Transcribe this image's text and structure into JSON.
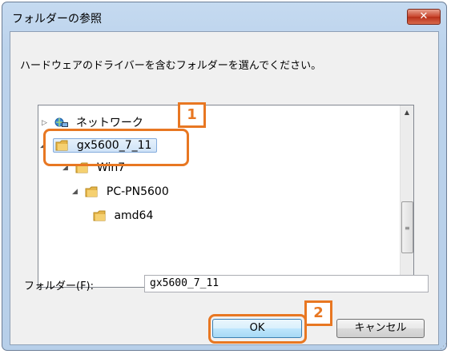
{
  "window": {
    "title": "フォルダーの参照",
    "close_label": "✕"
  },
  "instruction": "ハードウェアのドライバーを含むフォルダーを選んでください。",
  "tree": {
    "items": [
      {
        "label": "ネットワーク",
        "icon": "network-icon"
      },
      {
        "label": "gx5600_7_11",
        "icon": "folder-icon",
        "selected": true
      },
      {
        "label": "Win7",
        "icon": "folder-icon"
      },
      {
        "label": "PC-PN5600",
        "icon": "folder-icon"
      },
      {
        "label": "amd64",
        "icon": "folder-icon"
      }
    ]
  },
  "folder_field": {
    "label": "フォルダー(F):",
    "value": "gx5600_7_11"
  },
  "buttons": {
    "ok": "OK",
    "cancel": "キャンセル"
  },
  "callouts": {
    "one": "1",
    "two": "2"
  },
  "colors": {
    "callout": "#e87722",
    "selection": "#cfe3f7"
  }
}
